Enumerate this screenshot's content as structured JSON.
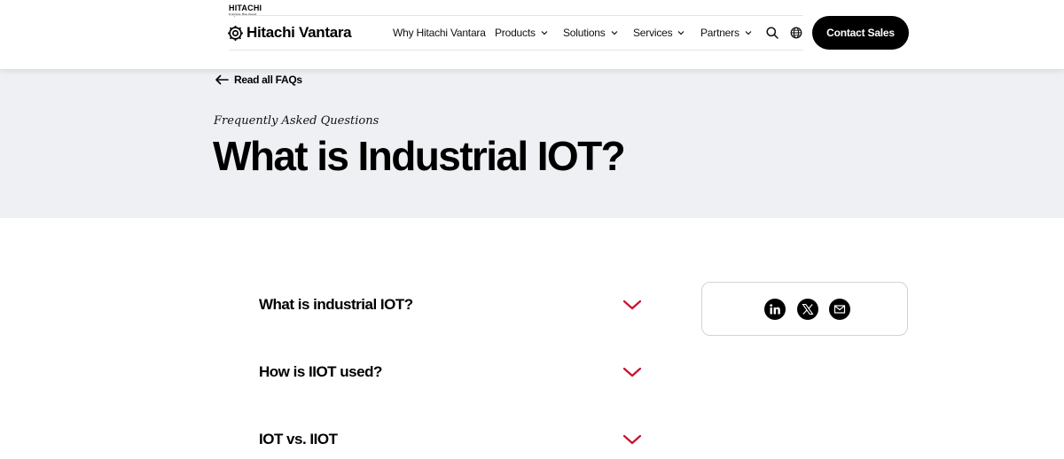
{
  "brand": {
    "top_wordmark": "HITACHI",
    "tagline": "Inspire the Next",
    "logo_text": "Hitachi Vantara",
    "logo_icon": "hitachi-vantara-mark-icon"
  },
  "nav": {
    "items": [
      {
        "label": "Why Hitachi Vantara",
        "has_dropdown": false
      },
      {
        "label": "Products",
        "has_dropdown": true
      },
      {
        "label": "Solutions",
        "has_dropdown": true
      },
      {
        "label": "Services",
        "has_dropdown": true
      },
      {
        "label": "Partners",
        "has_dropdown": true
      }
    ],
    "search_icon": "search-icon",
    "language_icon": "globe-icon",
    "cta_label": "Contact Sales"
  },
  "hero": {
    "back_link": "Read all FAQs",
    "eyebrow": "Frequently Asked Questions",
    "title": "What is Industrial IOT?"
  },
  "faqs": [
    {
      "question": "What is industrial IOT?"
    },
    {
      "question": "How is IIOT used?"
    },
    {
      "question": "IOT vs. IIOT"
    }
  ],
  "share": {
    "icons": [
      "linkedin-icon",
      "x-twitter-icon",
      "email-icon"
    ]
  },
  "colors": {
    "accent_red": "#c8102e",
    "hero_bg": "#eef0f3",
    "button_bg": "#000000"
  }
}
